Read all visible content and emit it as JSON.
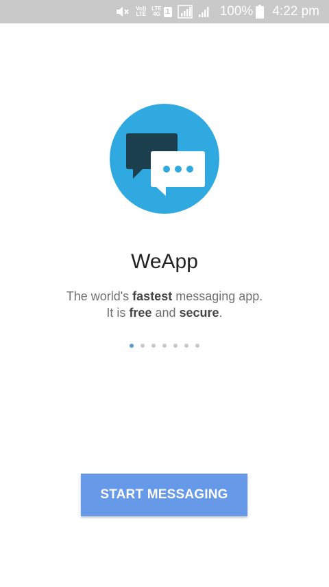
{
  "status_bar": {
    "volte_top": "Vo))",
    "volte_bottom": "LTE",
    "lte_top": "LTE",
    "lte_bottom": "4G",
    "sim_number": "1",
    "battery_percent": "100%",
    "time": "4:22 pm",
    "icons": [
      "mute-icon",
      "signal-icon",
      "signal-icon",
      "battery-icon"
    ]
  },
  "app": {
    "name": "WeApp",
    "tagline_line1_pre": "The world's ",
    "tagline_line1_bold": "fastest",
    "tagline_line1_post": " messaging app.",
    "tagline_line2_pre": "It is ",
    "tagline_line2_bold1": "free",
    "tagline_line2_mid": " and ",
    "tagline_line2_bold2": "secure",
    "tagline_line2_post": "."
  },
  "pager": {
    "count": 7,
    "active_index": 0
  },
  "actions": {
    "start_label": "START MESSAGING"
  },
  "colors": {
    "logo_circle": "#2fa9df",
    "logo_dark_bubble": "#1c3f4d",
    "button": "#6699e8",
    "status_bar": "#c9c9c9"
  }
}
